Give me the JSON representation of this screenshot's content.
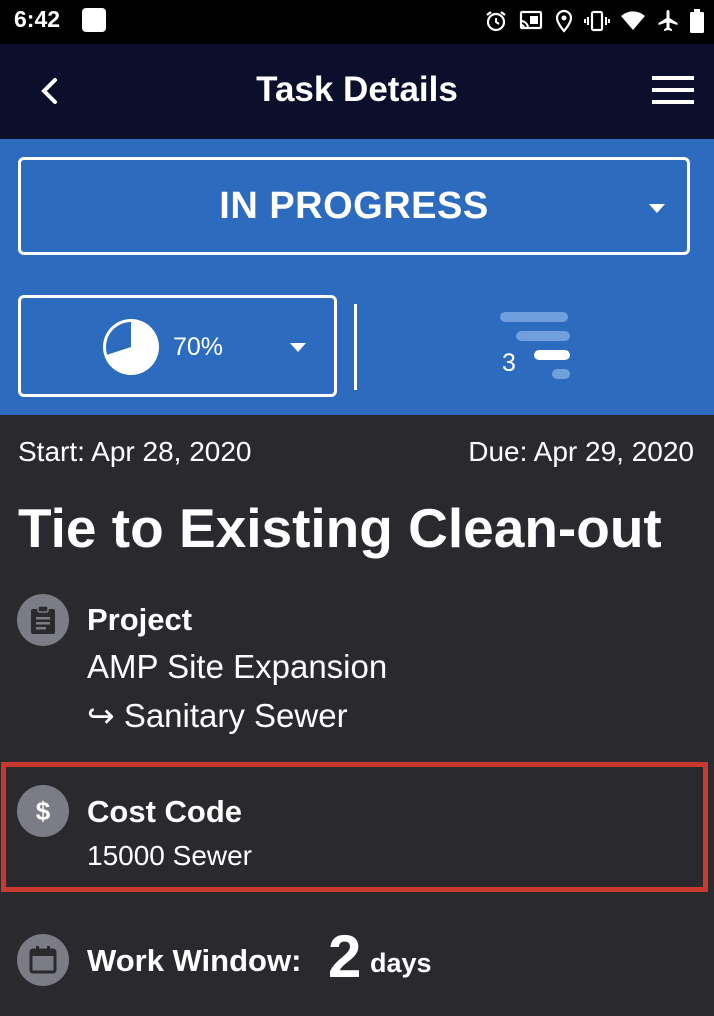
{
  "status_bar": {
    "time": "6:42",
    "icons": [
      "alarm-icon",
      "cast-icon",
      "location-icon",
      "vibrate-icon",
      "wifi-icon",
      "airplane-icon",
      "battery-icon"
    ]
  },
  "app_bar": {
    "title": "Task Details",
    "back_icon": "chevron-left-icon",
    "menu_icon": "hamburger-menu-icon"
  },
  "status": {
    "selected": "IN PROGRESS"
  },
  "progress": {
    "value_percent": 70,
    "label": "70%"
  },
  "priority": {
    "value": "3"
  },
  "dates": {
    "start": "Start: Apr 28, 2020",
    "due": "Due: Apr 29, 2020"
  },
  "task": {
    "title": "Tie to Existing Clean-out"
  },
  "project": {
    "label": "Project",
    "name": "AMP Site Expansion",
    "subproject": "↪ Sanitary Sewer"
  },
  "cost_code": {
    "label": "Cost Code",
    "value": "15000 Sewer",
    "icon_glyph": "$"
  },
  "work_window": {
    "label": "Work Window:",
    "value": "2",
    "unit": "days"
  },
  "colors": {
    "status_bar": "#000000",
    "app_bar": "#0b0f2c",
    "accent_blue": "#2d6bbf",
    "background": "#2a292e",
    "icon_circle": "#7b7c86",
    "highlight_red": "#c93a2e"
  }
}
